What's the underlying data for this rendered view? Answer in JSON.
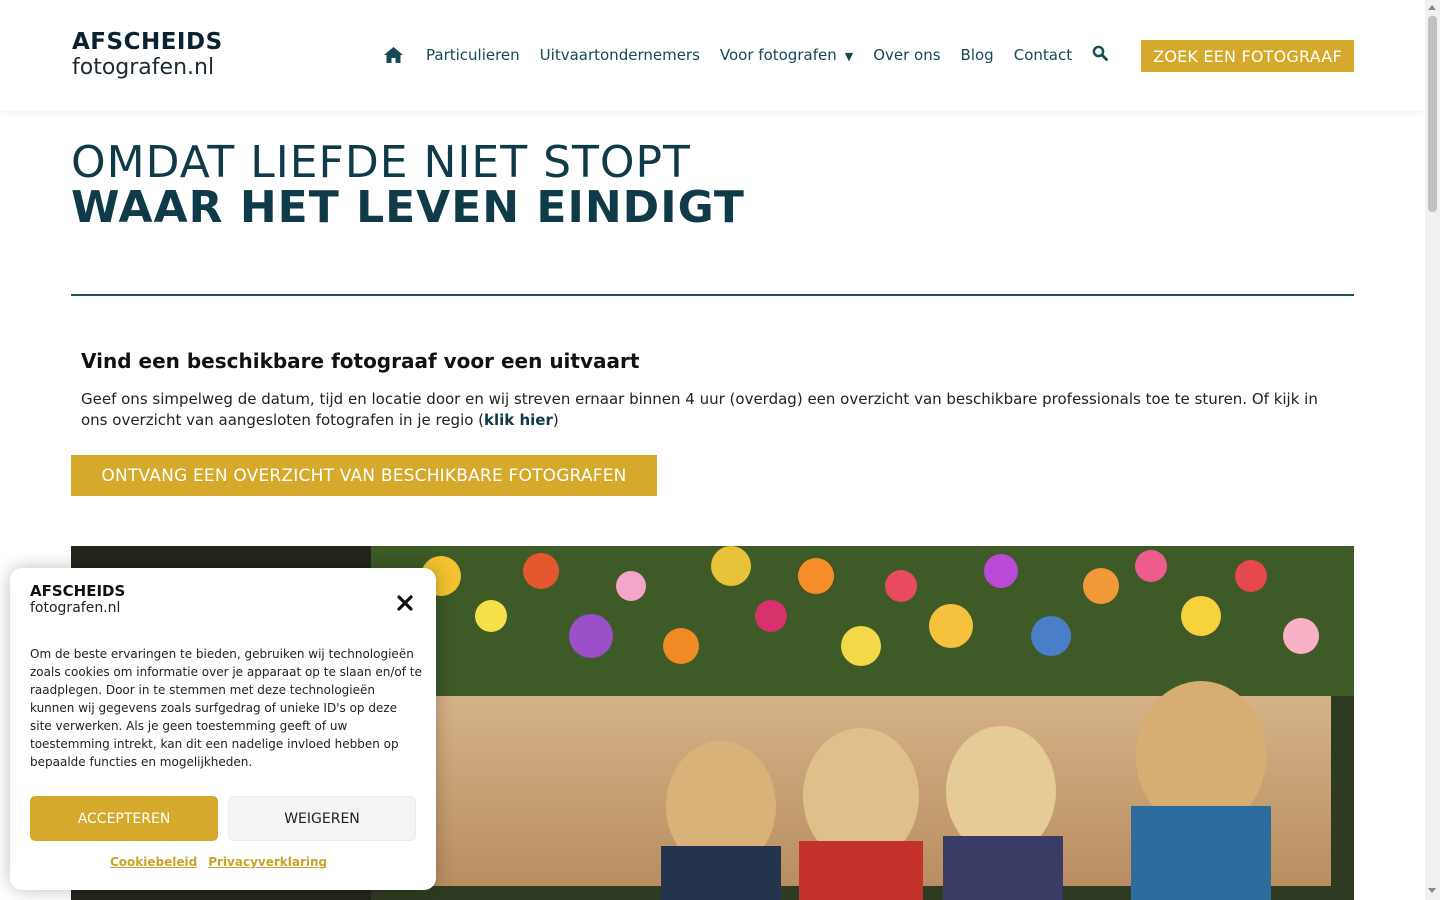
{
  "header": {
    "logo_line1": "AFSCHEIDS",
    "logo_line2": "fotografen.nl",
    "nav": {
      "home_icon": "home-icon",
      "items": [
        "Particulieren",
        "Uitvaartondernemers",
        "Voor fotografen",
        "Over ons",
        "Blog",
        "Contact"
      ],
      "dropdown_icon": "caret-down-icon",
      "search_icon": "search-icon"
    },
    "cta_label": "ZOEK EEN FOTOGRAAF"
  },
  "hero": {
    "line1": "OMDAT LIEFDE NIET STOPT",
    "line2": "WAAR HET LEVEN EINDIGT"
  },
  "section": {
    "title": "Vind een beschikbare fotograaf voor een uitvaart",
    "body_before": "Geef ons simpelweg de datum, tijd en locatie door en wij streven ernaar binnen 4 uur (overdag) een overzicht van beschikbare professionals toe te sturen. Of kijk in ons overzicht van aangesloten fotografen in je regio (",
    "link_label": "klik hier",
    "body_after": ")",
    "cta_label": "ONTVANG EEN OVERZICHT VAN BESCHIKBARE FOTOGRAFEN"
  },
  "cookie": {
    "logo_line1": "AFSCHEIDS",
    "logo_line2": "fotografen.nl",
    "close_icon": "close-icon",
    "text": "Om de beste ervaringen te bieden, gebruiken wij technologieën zoals cookies om informatie over je apparaat op te slaan en/of te raadplegen. Door in te stemmen met deze technologieën kunnen wij gegevens zoals surfgedrag of unieke ID's op deze site verwerken. Als je geen toestemming geeft of uw toestemming intrekt, kan dit een nadelige invloed hebben op bepaalde functies en mogelijkheden.",
    "accept_label": "ACCEPTEREN",
    "deny_label": "WEIGEREN",
    "link_policy": "Cookiebeleid",
    "link_privacy": "Privacyverklaring"
  },
  "colors": {
    "accent": "#d4a92c",
    "brand_dark": "#0f3a47",
    "nav_text": "#164a55"
  }
}
